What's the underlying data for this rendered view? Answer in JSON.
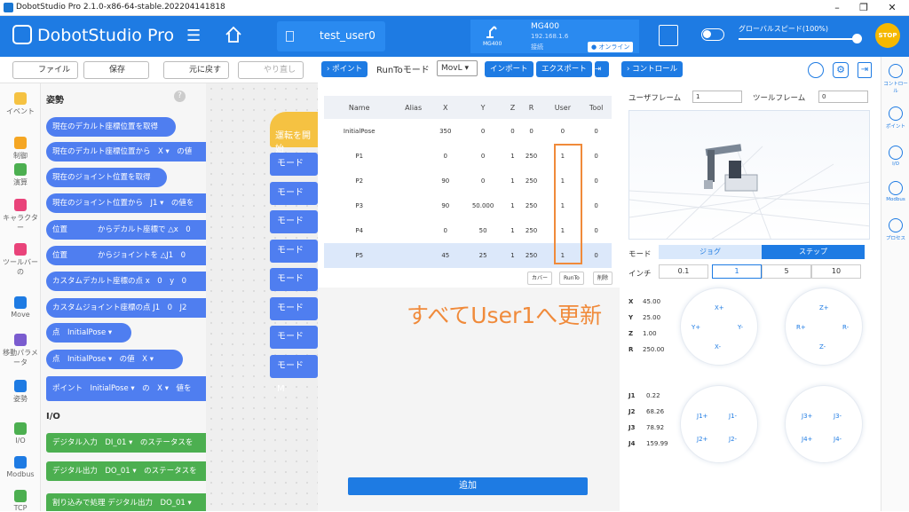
{
  "window": {
    "title": "DobotStudio Pro 2.1.0-x86-64-stable.202204141818",
    "minimize": "–",
    "restore": "❐",
    "close": "✕"
  },
  "header": {
    "brand": "DobotStudio Pro",
    "project_tab": "test_user0",
    "device": {
      "name": "MG400",
      "ip": "192.168.1.6",
      "status_small": "接続",
      "model_label": "MG400",
      "online": "● オンライン"
    },
    "speed_label": "グローバルスピード(100%)",
    "global_speed_percent": 100,
    "stop_label": "STOP",
    "accent_color": "#1e7be3"
  },
  "toolbar": {
    "file": "ファイル",
    "save": "保存",
    "undo": "元に戻す",
    "redo": "やり直し"
  },
  "categories": [
    "イベント",
    "制御",
    "演算",
    "キャラクター",
    "ツールバーの",
    "Move",
    "移動パラメータ",
    "姿勢",
    "I/O",
    "Modbus",
    "TCP"
  ],
  "palette": {
    "title": "姿勢",
    "help": "?",
    "blocks": [
      "現在のデカルト座標位置を取得",
      "現在のデカルト座標位置から　X ▾　の値",
      "現在のジョイント位置を取得",
      "現在のジョイント位置から　J1 ▾　の値を",
      "位置　　　　からデカルト座標で △x　0",
      "位置　　　　からジョイントを △J1　0",
      "カスタムデカルト座標の点 x　0　y　0",
      "カスタムジョイント座標の点 J1　0　J2",
      "点　InitialPose ▾",
      "点　InitialPose ▾　の値　X ▾",
      "ポイント　InitialPose ▾　の　X ▾　値を"
    ],
    "io_title": "I/O",
    "io_blocks": [
      "デジタル入力　DI_01 ▾　のステータスを",
      "デジタル出力　DO_01 ▾　のステータスを",
      "割り込みで処理 デジタル出力　DO_01 ▾"
    ]
  },
  "workspace": {
    "start_block": "運転を開始",
    "mode_label": "モード　M",
    "mode_count": 8
  },
  "points_panel": {
    "tab_point": "› ポイント",
    "runto_label": "RunToモード",
    "runto_value": "MovL ▾",
    "import": "インポート",
    "export": "エクスポート",
    "columns": [
      "Name",
      "Alias",
      "X",
      "Y",
      "Z",
      "R",
      "User",
      "Tool"
    ],
    "rows": [
      [
        "InitialPose",
        "",
        "350",
        "0",
        "0",
        "0",
        "0",
        "0"
      ],
      [
        "P1",
        "",
        "0",
        "0",
        "1",
        "250",
        "1",
        "0"
      ],
      [
        "P2",
        "",
        "90",
        "0",
        "1",
        "250",
        "1",
        "0"
      ],
      [
        "P3",
        "",
        "90",
        "50.000",
        "1",
        "250",
        "1",
        "0"
      ],
      [
        "P4",
        "",
        "0",
        "50",
        "1",
        "250",
        "1",
        "0"
      ],
      [
        "P5",
        "",
        "45",
        "25",
        "1",
        "250",
        "1",
        "0"
      ]
    ],
    "selected_row": 5,
    "cover": "カバー",
    "runto": "RunTo",
    "delete": "削除",
    "annotation": "すべてUser1へ更新",
    "annotation_color": "#f08a3a",
    "add": "追加"
  },
  "control_panel": {
    "tab_control": "› コントロール",
    "user_frame_label": "ユーザフレーム",
    "user_frame_value": "1",
    "tool_frame_label": "ツールフレーム",
    "tool_frame_value": "0",
    "mode_label": "モード",
    "jog": "ジョグ",
    "step": "ステップ",
    "inch_label": "インチ",
    "inch_values": [
      "0.1",
      "1",
      "5",
      "10"
    ],
    "inch_selected": 1,
    "cartesian": [
      {
        "k": "X",
        "v": "45.00"
      },
      {
        "k": "Y",
        "v": "25.00"
      },
      {
        "k": "Z",
        "v": "1.00"
      },
      {
        "k": "R",
        "v": "250.00"
      }
    ],
    "joints": [
      {
        "k": "J1",
        "v": "0.22"
      },
      {
        "k": "J2",
        "v": "68.26"
      },
      {
        "k": "J3",
        "v": "78.92"
      },
      {
        "k": "J4",
        "v": "159.99"
      }
    ],
    "dial_xy": [
      "X+",
      "Y+",
      "Y-",
      "X-"
    ],
    "dial_zr": [
      "Z+",
      "R+",
      "R-",
      "Z-"
    ],
    "dial_j12": [
      "J1+",
      "J1-",
      "J2+",
      "J2-"
    ],
    "dial_j34": [
      "J3+",
      "J3-",
      "J4+",
      "J4-"
    ]
  },
  "right_bar": [
    "コントロール",
    "ポイント",
    "I/O",
    "Modbus",
    "プロセス"
  ]
}
